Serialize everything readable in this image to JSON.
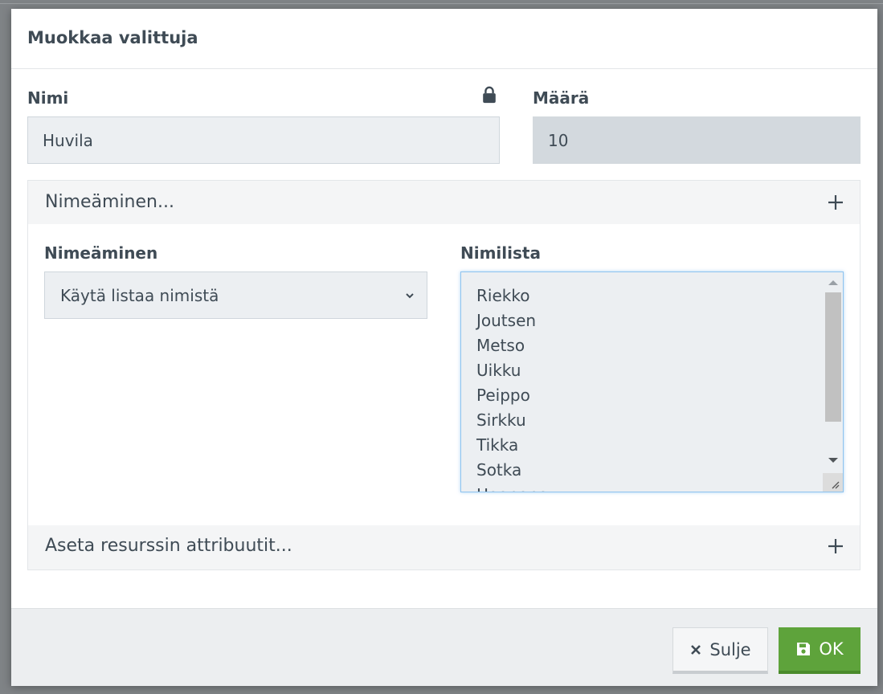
{
  "dialog": {
    "title": "Muokkaa valittuja"
  },
  "fields": {
    "name_label": "Nimi",
    "name_value": "Huvila",
    "count_label": "Määrä",
    "count_value": "10"
  },
  "naming_section": {
    "header": "Nimeäminen...",
    "naming_label": "Nimeäminen",
    "naming_select_value": "Käytä listaa nimistä",
    "namelist_label": "Nimilista",
    "namelist_items": [
      "Riekko",
      "Joutsen",
      "Metso",
      "Uikku",
      "Peippo",
      "Sirkku",
      "Tikka",
      "Sotka",
      "Haapana"
    ]
  },
  "attributes_section": {
    "header": "Aseta resurssin attribuutit..."
  },
  "footer": {
    "close_label": "Sulje",
    "ok_label": "OK"
  },
  "colors": {
    "accent_ok": "#5ea33b",
    "focus_border": "#8fc4ef",
    "text": "#3f4b55"
  },
  "icons": {
    "lock": "lock-icon",
    "expand": "plus-icon",
    "dropdown": "chevron-down-icon",
    "close": "x-icon",
    "save": "floppy-disk-icon"
  }
}
